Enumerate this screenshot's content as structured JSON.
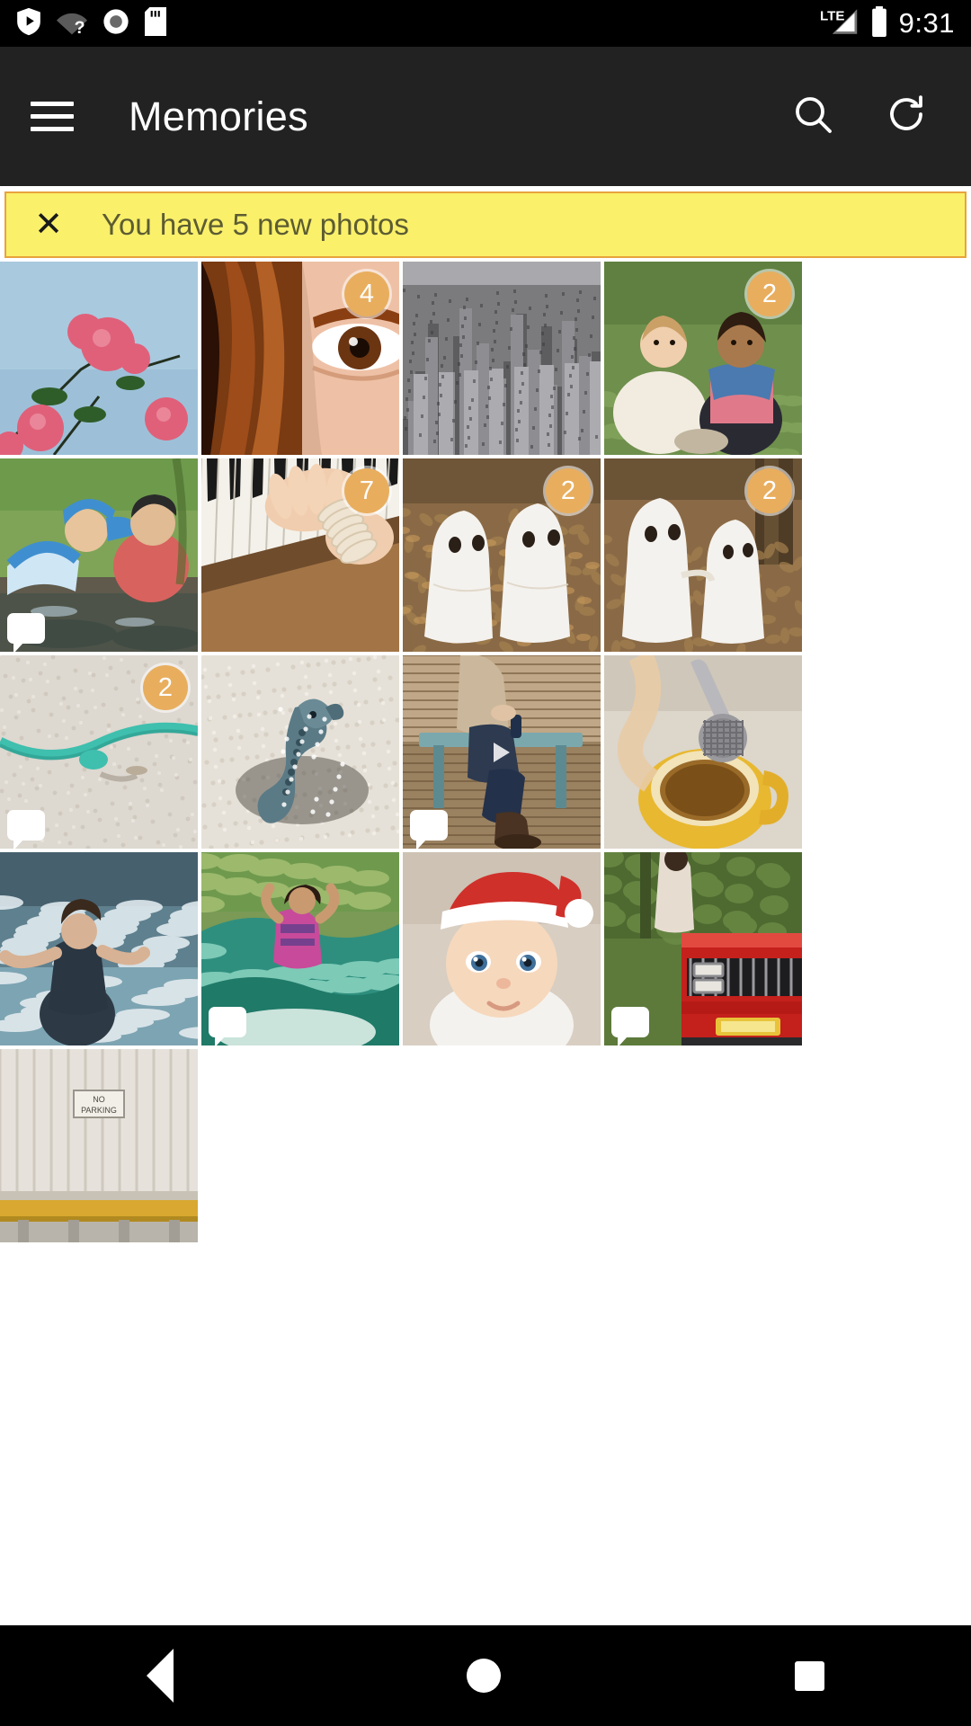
{
  "statusbar": {
    "icons": [
      "play-protect-shield-icon",
      "wifi-question-icon",
      "record-circle-icon",
      "sd-card-icon"
    ],
    "network_label": "LTE",
    "battery_icon": "battery-full-icon",
    "clock": "9:31"
  },
  "appbar": {
    "menu_icon": "hamburger-menu-icon",
    "title": "Memories",
    "search_icon": "search-icon",
    "refresh_icon": "refresh-icon",
    "background": "#222222"
  },
  "banner": {
    "close_label": "✕",
    "message": "You have 5 new photos",
    "background": "#faf06a",
    "border": "#e8a33d",
    "text_color": "#5c5c33"
  },
  "grid": {
    "columns": 4,
    "selection_color": "#f06a1b",
    "badge_color": "#e8ae5e",
    "tiles": [
      {
        "name": "pink-flowers-blue-sky",
        "selected": true,
        "badge": null,
        "comment": false,
        "video": false,
        "sky": "#a8c8dd",
        "accent": "#e0607a",
        "kind": "flowers"
      },
      {
        "name": "close-up-eye-red-hair",
        "selected": true,
        "badge": "4",
        "comment": false,
        "video": false,
        "sky": "#2a1208",
        "accent": "#d98a5e",
        "kind": "portrait"
      },
      {
        "name": "city-skyline-aerial",
        "selected": false,
        "badge": null,
        "comment": false,
        "video": false,
        "sky": "#6e6e70",
        "accent": "#9a9a9c",
        "kind": "city"
      },
      {
        "name": "two-girls-picnic-grass",
        "selected": false,
        "badge": "2",
        "comment": false,
        "video": false,
        "sky": "#6c8b4a",
        "accent": "#e8dcc8",
        "kind": "kids"
      },
      {
        "name": "two-boys-by-pond",
        "selected": false,
        "badge": null,
        "comment": true,
        "video": false,
        "sky": "#7ba055",
        "accent": "#3f8fd0",
        "kind": "pond"
      },
      {
        "name": "hands-on-piano-keys",
        "selected": false,
        "badge": "7",
        "comment": false,
        "video": false,
        "sky": "#c8a878",
        "accent": "#f2f0ea",
        "kind": "piano"
      },
      {
        "name": "two-ghost-costumes-leaves",
        "selected": false,
        "badge": "2",
        "comment": false,
        "video": false,
        "sky": "#8a6d4a",
        "accent": "#f4f2ee",
        "kind": "ghosts"
      },
      {
        "name": "ghost-costumes-by-tree",
        "selected": false,
        "badge": "2",
        "comment": false,
        "video": false,
        "sky": "#8a6d4a",
        "accent": "#f4f2ee",
        "kind": "ghosts2"
      },
      {
        "name": "rope-on-sand",
        "selected": false,
        "badge": "2",
        "comment": true,
        "video": false,
        "sky": "#ddd8d0",
        "accent": "#3fbfae",
        "kind": "rope"
      },
      {
        "name": "seahorse-on-sand",
        "selected": false,
        "badge": null,
        "comment": false,
        "video": false,
        "sky": "#e4e0d8",
        "accent": "#5a7a86",
        "kind": "seahorse"
      },
      {
        "name": "person-sitting-on-bench",
        "selected": false,
        "badge": null,
        "comment": true,
        "video": true,
        "sky": "#b39a7a",
        "accent": "#2d3a50",
        "kind": "bench"
      },
      {
        "name": "tea-infuser-yellow-cup",
        "selected": false,
        "badge": null,
        "comment": false,
        "video": false,
        "sky": "#ddd8ce",
        "accent": "#e8b830",
        "kind": "tea"
      },
      {
        "name": "woman-in-ocean-waves",
        "selected": false,
        "badge": null,
        "comment": false,
        "video": false,
        "sky": "#5a7a88",
        "accent": "#2a3a46",
        "kind": "ocean"
      },
      {
        "name": "surfer-woman-on-wave",
        "selected": false,
        "badge": null,
        "comment": true,
        "video": false,
        "sky": "#7a9a5a",
        "accent": "#c84a9a",
        "kind": "surf"
      },
      {
        "name": "baby-with-santa-hat",
        "selected": false,
        "badge": null,
        "comment": false,
        "video": false,
        "sky": "#d8cfc4",
        "accent": "#d0302a",
        "kind": "baby"
      },
      {
        "name": "red-vintage-car-front",
        "selected": false,
        "badge": null,
        "comment": true,
        "video": false,
        "sky": "#5d7a3a",
        "accent": "#c4201c",
        "kind": "car"
      },
      {
        "name": "no-parking-sign-wall",
        "selected": false,
        "badge": null,
        "comment": false,
        "video": false,
        "sky": "#ddd9d2",
        "accent": "#d8a830",
        "kind": "wall"
      }
    ]
  },
  "navbar": {
    "back_icon": "back-triangle-icon",
    "home_icon": "home-circle-icon",
    "recents_icon": "recents-square-icon"
  }
}
